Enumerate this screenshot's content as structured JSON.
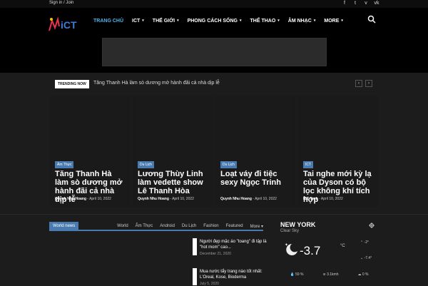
{
  "topbar": {
    "signin": "Sign in / Join",
    "social": [
      "f",
      "t",
      "v",
      "vk"
    ]
  },
  "header": {
    "logo_text": "iCT",
    "nav": [
      {
        "label": "TRANG CHỦ",
        "active": true,
        "caret": false
      },
      {
        "label": "ICT",
        "active": false,
        "caret": true
      },
      {
        "label": "THẾ GIỚI",
        "active": false,
        "caret": true
      },
      {
        "label": "PHONG CÁCH SỐNG",
        "active": false,
        "caret": true
      },
      {
        "label": "THỂ THAO",
        "active": false,
        "caret": true
      },
      {
        "label": "ÂM NHẠC",
        "active": false,
        "caret": true
      },
      {
        "label": "MORE",
        "active": false,
        "caret": true
      }
    ]
  },
  "trending": {
    "badge": "TRENDING NOW",
    "title": "Tăng Thanh Hà làm sò dương mở hành đãi cả nhà dịp lễ",
    "prev": "‹",
    "next": "›"
  },
  "cards": [
    {
      "tag": "Ẩm Thực",
      "title": "Tăng Thanh Hà làm sò dương mở hành đãi cả nhà dịp lễ",
      "author": "Quynh Nhu Hoang",
      "date": "April 10, 2022"
    },
    {
      "tag": "Du Lịch",
      "title": "Lương Thùy Linh làm vedette show Lê Thanh Hòa",
      "author": "Quynh Nhu Hoang",
      "date": "April 10, 2022"
    },
    {
      "tag": "Du Lịch",
      "title": "Loạt váy đi tiệc sexy Ngọc Trinh",
      "author": "Quynh Nhu Hoang",
      "date": "April 10, 2022"
    },
    {
      "tag": "ICT",
      "title": "Tai nghe mới kỳ lạ của Dyson có bộ lọc không khí tích hợp",
      "author": "ICT Tech",
      "date": "April 10, 2022"
    }
  ],
  "world_news": {
    "label": "World news",
    "tabs": [
      "World",
      "Ẩm Thực",
      "Android",
      "Du Lịch",
      "Fashion",
      "Featured",
      "More ▾"
    ],
    "items": [
      {
        "title": "Người đẹp mặc áo \"toang\" đi tập là \"hot mom\" cao...",
        "date": "December 21, 2020"
      },
      {
        "title": "Mua nước tẩy trang nào tốt nhất: L'Oreal, Kose, Bioderma",
        "date": "July 5, 2020"
      }
    ]
  },
  "weather": {
    "city": "NEW YORK",
    "desc": "Clear Sky",
    "temp": "-3.7",
    "unit": "°C",
    "high": "-2°",
    "low": "-7.4°",
    "humidity": "59 %",
    "wind": "3.1kmh",
    "clouds": "0 %"
  },
  "colors": {
    "accent": "#4db2ec",
    "tag": "#4a7bb0"
  }
}
